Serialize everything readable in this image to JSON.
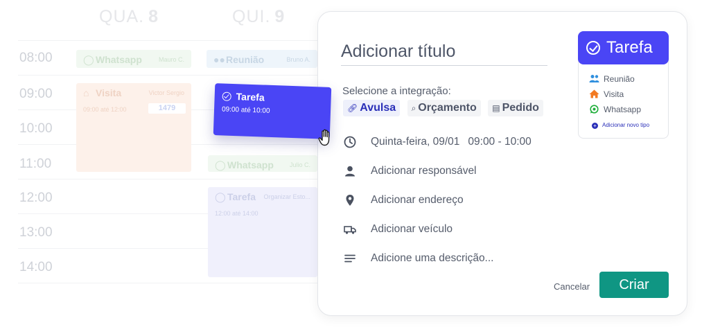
{
  "calendar": {
    "days": [
      {
        "name": "QUA.",
        "number": "8"
      },
      {
        "name": "QUI.",
        "number": "9"
      }
    ],
    "hours": [
      "08:00",
      "09:00",
      "10:00",
      "11:00",
      "12:00",
      "13:00",
      "14:00"
    ],
    "events": {
      "whatsapp_1": {
        "title": "Whatsapp",
        "person": "Mauro C."
      },
      "reuniao": {
        "title": "Reunião",
        "person": "Bruno A."
      },
      "visita": {
        "title": "Visita",
        "person": "Victor Sergio",
        "time": "09:00 até 12:00",
        "badge": "1479"
      },
      "whatsapp_2": {
        "title": "Whatsapp",
        "person": "Julio C."
      },
      "tarefa_2": {
        "title": "Tarefa",
        "person": "Organizar Esto...",
        "time": "12:00 até 14:00"
      }
    },
    "dragged": {
      "title": "Tarefa",
      "time": "09:00 até 10:00"
    }
  },
  "modal": {
    "title_placeholder": "Adicionar título",
    "integration_label": "Selecione a integração:",
    "integrations": [
      {
        "label": "Avulsa",
        "icon": "link-icon",
        "active": true
      },
      {
        "label": "Orçamento",
        "icon": "search-doc-icon",
        "active": false
      },
      {
        "label": "Pedido",
        "icon": "order-icon",
        "active": false
      }
    ],
    "date": "Quinta-feira, 09/01",
    "time_range": "09:00 - 10:00",
    "responsible": "Adicionar responsável",
    "address": "Adicionar endereço",
    "vehicle": "Adicionar veículo",
    "description": "Adicione uma descrição...",
    "cancel_label": "Cancelar",
    "create_label": "Criar",
    "type_selector": {
      "selected": "Tarefa",
      "options": [
        "Reunião",
        "Visita",
        "Whatsapp"
      ],
      "add_label": "Adicionar novo tipo"
    }
  },
  "colors": {
    "primary": "#4a45f5",
    "create_button": "#0f9683",
    "link_blue": "#2a2fb8",
    "reuniao": "#2f8fde",
    "visita": "#f27a22",
    "whatsapp": "#1fae3a"
  }
}
